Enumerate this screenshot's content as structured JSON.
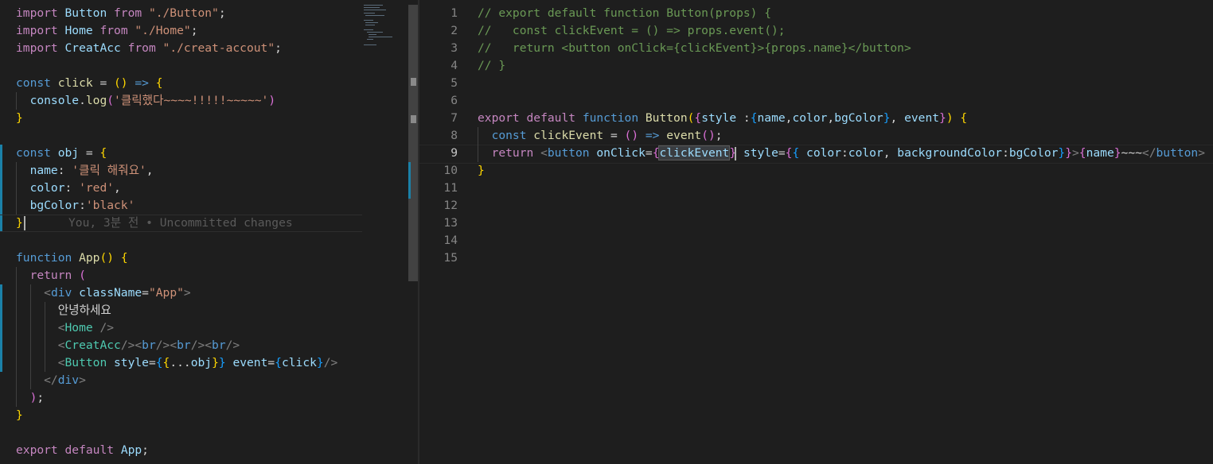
{
  "left_editor": {
    "lines": [
      [
        {
          "t": "import ",
          "c": "ctl"
        },
        {
          "t": "Button",
          "c": "v"
        },
        {
          "t": " from ",
          "c": "ctl"
        },
        {
          "t": "\"./Button\"",
          "c": "str"
        },
        {
          "t": ";",
          "c": "p"
        }
      ],
      [
        {
          "t": "import ",
          "c": "ctl"
        },
        {
          "t": "Home",
          "c": "v"
        },
        {
          "t": " from ",
          "c": "ctl"
        },
        {
          "t": "\"./Home\"",
          "c": "str"
        },
        {
          "t": ";",
          "c": "p"
        }
      ],
      [
        {
          "t": "import ",
          "c": "ctl"
        },
        {
          "t": "CreatAcc",
          "c": "v"
        },
        {
          "t": " from ",
          "c": "ctl"
        },
        {
          "t": "\"./creat-accout\"",
          "c": "str"
        },
        {
          "t": ";",
          "c": "p"
        }
      ],
      [],
      [
        {
          "t": "const ",
          "c": "kw"
        },
        {
          "t": "click",
          "c": "fn"
        },
        {
          "t": " = ",
          "c": "p"
        },
        {
          "t": "()",
          "c": "b1"
        },
        {
          "t": " => ",
          "c": "kw"
        },
        {
          "t": "{",
          "c": "b1"
        }
      ],
      [
        {
          "t": "  console",
          "c": "v"
        },
        {
          "t": ".",
          "c": "p"
        },
        {
          "t": "log",
          "c": "fn"
        },
        {
          "t": "(",
          "c": "b2"
        },
        {
          "t": "'클릭했다~~~~!!!!!~~~~~'",
          "c": "str"
        },
        {
          "t": ")",
          "c": "b2"
        }
      ],
      [
        {
          "t": "}",
          "c": "b1"
        }
      ],
      [],
      [
        {
          "t": "const ",
          "c": "kw"
        },
        {
          "t": "obj",
          "c": "v"
        },
        {
          "t": " = ",
          "c": "p"
        },
        {
          "t": "{",
          "c": "b1"
        }
      ],
      [
        {
          "t": "  name",
          "c": "v"
        },
        {
          "t": ": ",
          "c": "p"
        },
        {
          "t": "'클릭 해줘요'",
          "c": "str"
        },
        {
          "t": ",",
          "c": "p"
        }
      ],
      [
        {
          "t": "  color",
          "c": "v"
        },
        {
          "t": ": ",
          "c": "p"
        },
        {
          "t": "'red'",
          "c": "str"
        },
        {
          "t": ",",
          "c": "p"
        }
      ],
      [
        {
          "t": "  bgColor",
          "c": "v"
        },
        {
          "t": ":",
          "c": "p"
        },
        {
          "t": "'black'",
          "c": "str"
        }
      ],
      [
        {
          "t": "}",
          "c": "b1"
        }
      ],
      [],
      [
        {
          "t": "function ",
          "c": "kw"
        },
        {
          "t": "App",
          "c": "fn"
        },
        {
          "t": "()",
          "c": "b1"
        },
        {
          "t": " ",
          "c": "p"
        },
        {
          "t": "{",
          "c": "b1"
        }
      ],
      [
        {
          "t": "  return ",
          "c": "ctl"
        },
        {
          "t": "(",
          "c": "b2"
        }
      ],
      [
        {
          "t": "    <",
          "c": "dim"
        },
        {
          "t": "div",
          "c": "kw"
        },
        {
          "t": " className",
          "c": "v"
        },
        {
          "t": "=",
          "c": "p"
        },
        {
          "t": "\"App\"",
          "c": "str"
        },
        {
          "t": ">",
          "c": "dim"
        }
      ],
      [
        {
          "t": "      안녕하세요",
          "c": "jtx"
        }
      ],
      [
        {
          "t": "      <",
          "c": "dim"
        },
        {
          "t": "Home",
          "c": "tg"
        },
        {
          "t": " />",
          "c": "dim"
        }
      ],
      [
        {
          "t": "      <",
          "c": "dim"
        },
        {
          "t": "CreatAcc",
          "c": "tg"
        },
        {
          "t": "/><",
          "c": "dim"
        },
        {
          "t": "br",
          "c": "kw"
        },
        {
          "t": "/><",
          "c": "dim"
        },
        {
          "t": "br",
          "c": "kw"
        },
        {
          "t": "/><",
          "c": "dim"
        },
        {
          "t": "br",
          "c": "kw"
        },
        {
          "t": "/>",
          "c": "dim"
        }
      ],
      [
        {
          "t": "      <",
          "c": "dim"
        },
        {
          "t": "Button",
          "c": "tg"
        },
        {
          "t": " style",
          "c": "v"
        },
        {
          "t": "=",
          "c": "p"
        },
        {
          "t": "{",
          "c": "b3"
        },
        {
          "t": "{",
          "c": "b1"
        },
        {
          "t": "...",
          "c": "p"
        },
        {
          "t": "obj",
          "c": "v"
        },
        {
          "t": "}",
          "c": "b1"
        },
        {
          "t": "}",
          "c": "b3"
        },
        {
          "t": " event",
          "c": "v"
        },
        {
          "t": "=",
          "c": "p"
        },
        {
          "t": "{",
          "c": "b3"
        },
        {
          "t": "click",
          "c": "v"
        },
        {
          "t": "}",
          "c": "b3"
        },
        {
          "t": "/>",
          "c": "dim"
        }
      ],
      [
        {
          "t": "    </",
          "c": "dim"
        },
        {
          "t": "div",
          "c": "kw"
        },
        {
          "t": ">",
          "c": "dim"
        }
      ],
      [
        {
          "t": "  ",
          "c": "p"
        },
        {
          "t": ")",
          "c": "b2"
        },
        {
          "t": ";",
          "c": "p"
        }
      ],
      [
        {
          "t": "}",
          "c": "b1"
        }
      ],
      [],
      [
        {
          "t": "export ",
          "c": "ctl"
        },
        {
          "t": "default ",
          "c": "ctl"
        },
        {
          "t": "App",
          "c": "v"
        },
        {
          "t": ";",
          "c": "p"
        }
      ]
    ],
    "blame_annotation": "You, 3분 전 • Uncommitted changes"
  },
  "right_editor": {
    "line_numbers": [
      "1",
      "2",
      "3",
      "4",
      "5",
      "6",
      "7",
      "8",
      "9",
      "10",
      "11",
      "12",
      "13",
      "14",
      "15"
    ],
    "active_line": "9",
    "lines": [
      [
        {
          "t": "// export default function Button(props) {",
          "c": "cm"
        }
      ],
      [
        {
          "t": "//   const clickEvent = () => props.event();",
          "c": "cm"
        }
      ],
      [
        {
          "t": "//   return <button onClick={clickEvent}>{props.name}</button>",
          "c": "cm"
        }
      ],
      [
        {
          "t": "// }",
          "c": "cm"
        }
      ],
      [],
      [],
      [
        {
          "t": "export ",
          "c": "ctl"
        },
        {
          "t": "default ",
          "c": "ctl"
        },
        {
          "t": "function ",
          "c": "kw"
        },
        {
          "t": "Button",
          "c": "fn"
        },
        {
          "t": "(",
          "c": "b1"
        },
        {
          "t": "{",
          "c": "b2"
        },
        {
          "t": "style ",
          "c": "v"
        },
        {
          "t": ":",
          "c": "p"
        },
        {
          "t": "{",
          "c": "b3"
        },
        {
          "t": "name",
          "c": "v"
        },
        {
          "t": ",",
          "c": "p"
        },
        {
          "t": "color",
          "c": "v"
        },
        {
          "t": ",",
          "c": "p"
        },
        {
          "t": "bgColor",
          "c": "v"
        },
        {
          "t": "}",
          "c": "b3"
        },
        {
          "t": ", ",
          "c": "p"
        },
        {
          "t": "event",
          "c": "v"
        },
        {
          "t": "}",
          "c": "b2"
        },
        {
          "t": ")",
          "c": "b1"
        },
        {
          "t": " ",
          "c": "p"
        },
        {
          "t": "{",
          "c": "b1"
        }
      ],
      [
        {
          "t": "  const ",
          "c": "kw"
        },
        {
          "t": "clickEvent",
          "c": "fn"
        },
        {
          "t": " = ",
          "c": "p"
        },
        {
          "t": "()",
          "c": "b2"
        },
        {
          "t": " => ",
          "c": "kw"
        },
        {
          "t": "event",
          "c": "fn"
        },
        {
          "t": "()",
          "c": "b2"
        },
        {
          "t": ";",
          "c": "p"
        }
      ],
      [
        {
          "t": "  return ",
          "c": "ctl"
        },
        {
          "t": "<",
          "c": "dim"
        },
        {
          "t": "button",
          "c": "kw"
        },
        {
          "t": " onClick",
          "c": "v"
        },
        {
          "t": "=",
          "c": "p"
        },
        {
          "t": "{",
          "c": "b2"
        },
        {
          "t": "clickEvent",
          "c": "v match"
        },
        {
          "t": "}",
          "c": "b2"
        },
        {
          "t": " style",
          "c": "v"
        },
        {
          "t": "=",
          "c": "p"
        },
        {
          "t": "{",
          "c": "b2"
        },
        {
          "t": "{",
          "c": "b3"
        },
        {
          "t": " color",
          "c": "v"
        },
        {
          "t": ":",
          "c": "p"
        },
        {
          "t": "color",
          "c": "v"
        },
        {
          "t": ", ",
          "c": "p"
        },
        {
          "t": "backgroundColor",
          "c": "v"
        },
        {
          "t": ":",
          "c": "p"
        },
        {
          "t": "bgColor",
          "c": "v"
        },
        {
          "t": "}",
          "c": "b3"
        },
        {
          "t": "}",
          "c": "b2"
        },
        {
          "t": ">",
          "c": "dim"
        },
        {
          "t": "{",
          "c": "b2"
        },
        {
          "t": "name",
          "c": "v"
        },
        {
          "t": "}",
          "c": "b2"
        },
        {
          "t": "~~~",
          "c": "jtx"
        },
        {
          "t": "</",
          "c": "dim"
        },
        {
          "t": "button",
          "c": "kw"
        },
        {
          "t": ">",
          "c": "dim"
        }
      ],
      [
        {
          "t": "}",
          "c": "b1"
        }
      ],
      [],
      [],
      [],
      [],
      []
    ]
  }
}
